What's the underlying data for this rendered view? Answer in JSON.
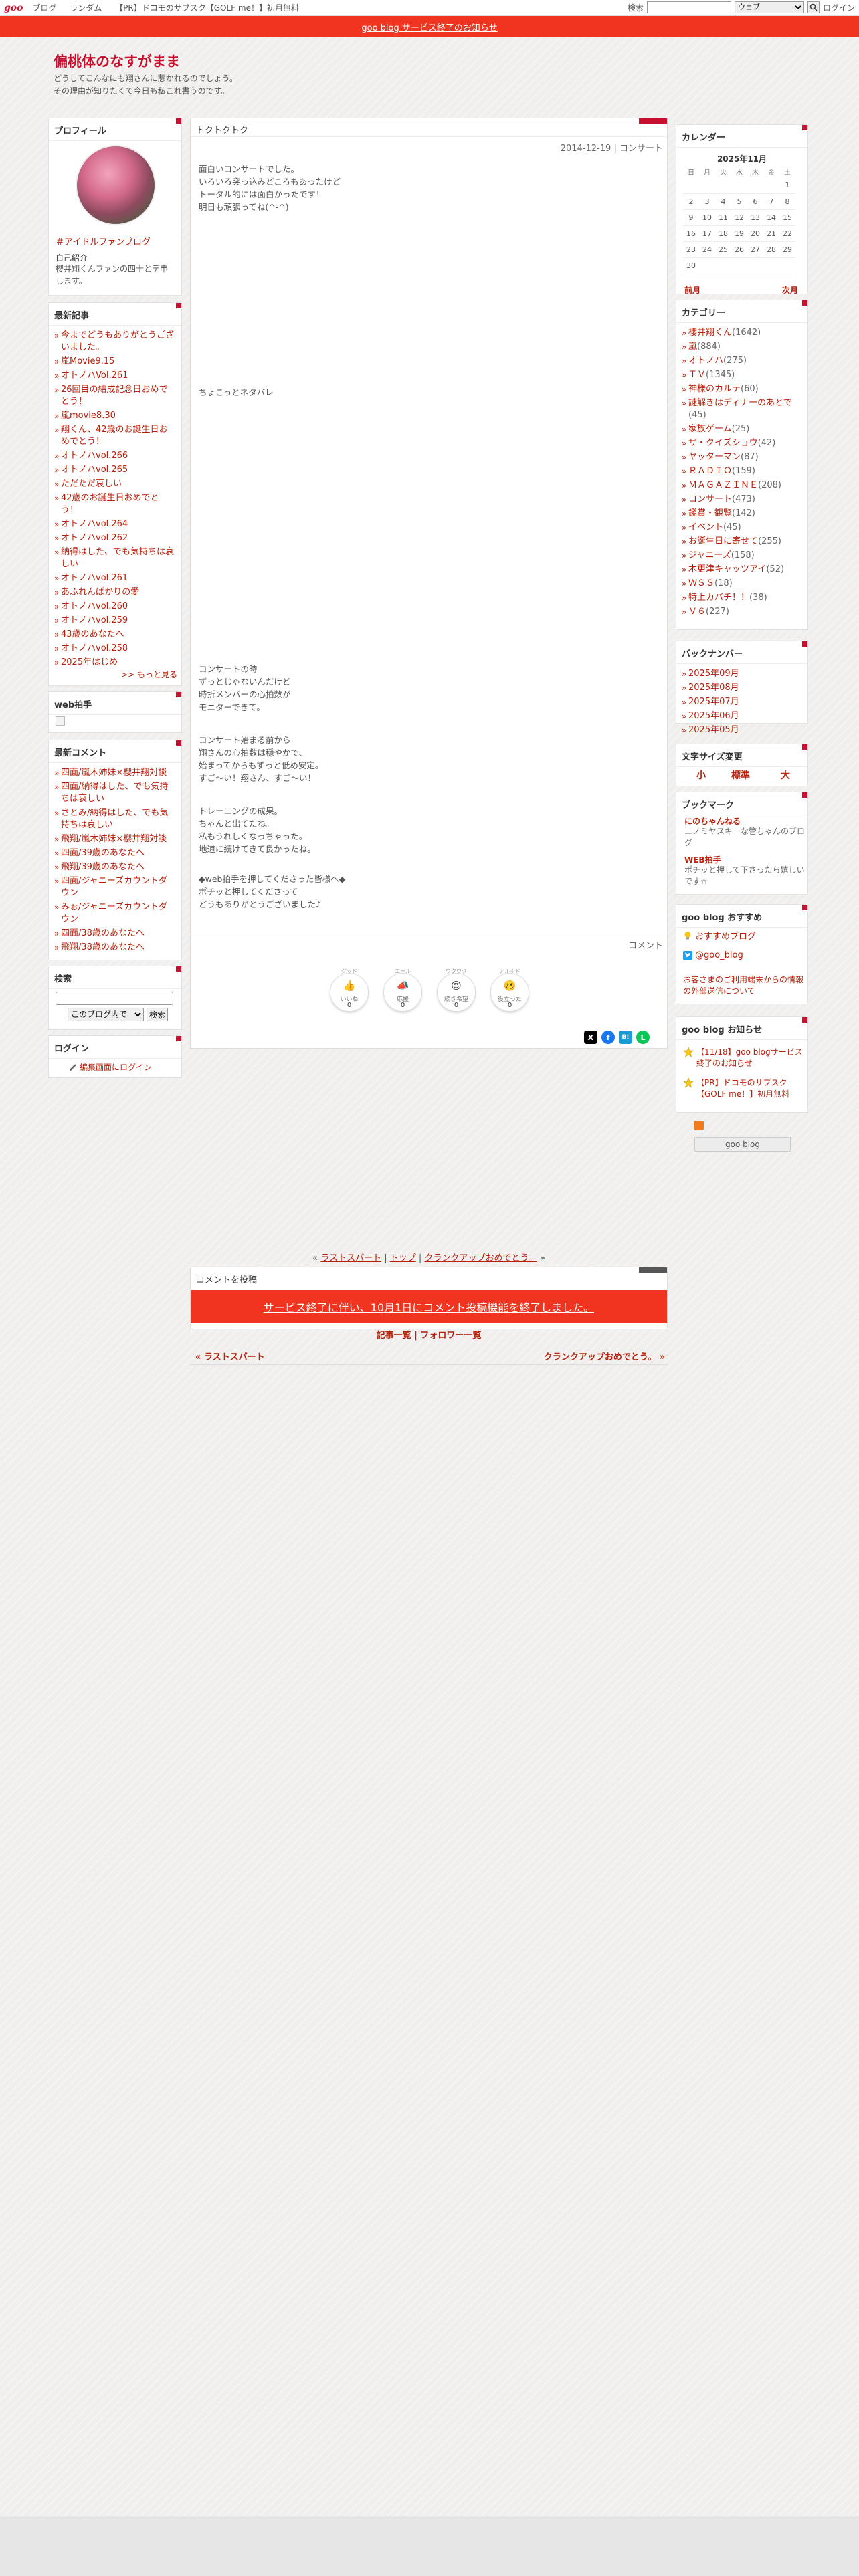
{
  "topbar": {
    "logo": "goo",
    "nav": [
      "ブログ",
      "ランダム",
      "【PR】ドコモのサブスク【GOLF me！】初月無料"
    ],
    "search_label": "検索",
    "search_value": "",
    "search_scope": "ウェブ",
    "login": "ログイン"
  },
  "notice": {
    "text": "goo blog サービス終了のお知らせ"
  },
  "header": {
    "title": "偏桃体のなすがまま",
    "desc_line1": "どうしてこんなにも翔さんに惹かれるのでしょう。",
    "desc_line2": "その理由が知りたくて今日も私これ書うのです。"
  },
  "profile": {
    "heading": "プロフィール",
    "fan_link": "＃アイドルファンブログ",
    "intro_title": "自己紹介",
    "intro": "櫻井翔くんファンの四十とデ申します。"
  },
  "recent_posts": {
    "heading": "最新記事",
    "items": [
      "今までどうもありがとうございました。",
      "嵐Movie9.15",
      "オトノハVol.261",
      "26回目の結成記念日おめでとう！",
      "嵐movie8.30",
      "翔くん、42歳のお誕生日おめでとう！",
      "オトノハvol.266",
      "オトノハvol.265",
      "ただただ哀しい",
      "42歳のお誕生日おめでとう！",
      "オトノハvol.264",
      "オトノハvol.262",
      "納得はした、でも気持ちは哀しい",
      "オトノハvol.261",
      "あふれんばかりの愛",
      "オトノハvol.260",
      "オトノハvol.259",
      "43歳のあなたへ",
      "オトノハvol.258",
      "2025年はじめ"
    ],
    "more": ">> もっと見る"
  },
  "web_clap": {
    "heading": "web拍手"
  },
  "recent_comments": {
    "heading": "最新コメント",
    "items": [
      "四面/嵐木姉妹×櫻井翔対談",
      "四面/納得はした、でも気持ちは哀しい",
      "さとみ/納得はした、でも気持ちは哀しい",
      "飛翔/嵐木姉妹×櫻井翔対談",
      "四面/39歳のあなたへ",
      "飛翔/39歳のあなたへ",
      "四面/ジャニーズカウントダウン",
      "みぉ/ジャニーズカウントダウン",
      "四面/38歳のあなたへ",
      "飛翔/38歳のあなたへ"
    ]
  },
  "search": {
    "heading": "検索",
    "scope": "このブログ内で",
    "button": "検索"
  },
  "login_box": {
    "heading": "ログイン",
    "link": "編集画面にログイン"
  },
  "post": {
    "tab_title": "トクトクトク",
    "date": "2014-12-19",
    "separator": "|",
    "category": "コンサート",
    "para1": [
      "面白いコンサートでした。",
      "いろいろ突っ込みどころもあったけど",
      "トータル的には面白かったです！",
      "明日も頑張ってね(^-^)"
    ],
    "para2": [
      "ちょこっとネタバレ"
    ],
    "para3": [
      "コンサートの時",
      "ずっとじゃないんだけど",
      "時折メンバーの心拍数が",
      "モニターできて。"
    ],
    "para4": [
      "コンサート始まる前から",
      "翔さんの心拍数は穏やかで、",
      "始まってからもずっと低め安定。",
      "すご〜い！翔さん、すご〜い！"
    ],
    "para5": [
      "トレーニングの成果。",
      "ちゃんと出てたね。",
      "私もうれしくなっちゃった。",
      "地道に続けてきて良かったね。"
    ],
    "para6": [
      "◆web拍手を押してくださった皆様へ◆",
      "ポチッと押してくださって",
      "どうもありがとうございました♪"
    ],
    "comment_link": "コメント",
    "reactions": [
      {
        "top": "グッド",
        "emoji": "👍",
        "label": "いいね",
        "count": "0"
      },
      {
        "top": "エール",
        "emoji": "📣",
        "label": "応援",
        "count": "0"
      },
      {
        "top": "ワクワク",
        "emoji": "😍",
        "label": "続き希望",
        "count": "0"
      },
      {
        "top": "ナルホド",
        "emoji": "🥴",
        "label": "役立った",
        "count": "0"
      }
    ],
    "share": [
      "X",
      "f",
      "B!",
      "L"
    ]
  },
  "post_nav": {
    "prev_arrow": "«",
    "prev": "ラストスパート",
    "sep": "|",
    "top": "トップ",
    "next": "クランクアップおめでとう。",
    "next_arrow": "»"
  },
  "comment_form": {
    "heading": "コメントを投稿",
    "notice": "サービス終了に伴い、10月1日にコメント投稿機能を終了しました。"
  },
  "list_links": {
    "articles": "記事一覧",
    "sep": "|",
    "follows": "フォロワー一覧"
  },
  "prev_post": "« ラストスパート",
  "next_post": "クランクアップおめでとう。 »",
  "calendar": {
    "heading": "カレンダー",
    "month": "2025年11月",
    "weekdays": [
      "日",
      "月",
      "火",
      "水",
      "木",
      "金",
      "土"
    ],
    "weeks": [
      [
        "",
        "",
        "",
        "",
        "",
        "",
        "1"
      ],
      [
        "2",
        "3",
        "4",
        "5",
        "6",
        "7",
        "8"
      ],
      [
        "9",
        "10",
        "11",
        "12",
        "13",
        "14",
        "15"
      ],
      [
        "16",
        "17",
        "18",
        "19",
        "20",
        "21",
        "22"
      ],
      [
        "23",
        "24",
        "25",
        "26",
        "27",
        "28",
        "29"
      ],
      [
        "30",
        "",
        "",
        "",
        "",
        "",
        ""
      ]
    ],
    "prev": "前月",
    "next": "次月"
  },
  "categories": {
    "heading": "カテゴリー",
    "items": [
      {
        "name": "櫻井翔くん",
        "count": "(1642)"
      },
      {
        "name": "嵐",
        "count": "(884)"
      },
      {
        "name": "オトノハ",
        "count": "(275)"
      },
      {
        "name": "ＴＶ",
        "count": "(1345)"
      },
      {
        "name": "神様のカルテ",
        "count": "(60)"
      },
      {
        "name": "謎解きはディナーのあとで",
        "count": "(45)"
      },
      {
        "name": "家族ゲーム",
        "count": "(25)"
      },
      {
        "name": "ザ・クイズショウ",
        "count": "(42)"
      },
      {
        "name": "ヤッターマン",
        "count": "(87)"
      },
      {
        "name": "ＲＡＤＩＯ",
        "count": "(159)"
      },
      {
        "name": "ＭＡＧＡＺＩＮＥ",
        "count": "(208)"
      },
      {
        "name": "コンサート",
        "count": "(473)"
      },
      {
        "name": "鑑賞・観覧",
        "count": "(142)"
      },
      {
        "name": "イベント",
        "count": "(45)"
      },
      {
        "name": "お誕生日に寄せて",
        "count": "(255)"
      },
      {
        "name": "ジャニーズ",
        "count": "(158)"
      },
      {
        "name": "木更津キャッツアイ",
        "count": "(52)"
      },
      {
        "name": "ＷＳＳ",
        "count": "(18)"
      },
      {
        "name": "特上カバチ！！",
        "count": "(38)"
      },
      {
        "name": "Ｖ６",
        "count": "(227)"
      }
    ]
  },
  "backnumber": {
    "heading": "バックナンバー",
    "items": [
      "2025年09月",
      "2025年08月",
      "2025年07月",
      "2025年06月",
      "2025年05月"
    ]
  },
  "font_size": {
    "heading": "文字サイズ変更",
    "small": "小",
    "medium": "標準",
    "large": "大"
  },
  "bookmarks": {
    "heading": "ブックマーク",
    "items": [
      {
        "title": "にのちゃんねる",
        "desc": "ニノミヤスキーな管ちゃんのブログ"
      },
      {
        "title": "WEB拍手",
        "desc": "ポチッと押して下さったら嬉しいです☆"
      }
    ]
  },
  "goo_recommend": {
    "heading": "goo blog おすすめ",
    "items": [
      "おすすめブログ",
      "@goo_blog"
    ],
    "note": "お客さまのご利用端末からの情報の外部送信について"
  },
  "goo_news": {
    "heading": "goo blog お知らせ",
    "items": [
      "【11/18】goo blogサービス終了のお知らせ",
      "【PR】ドコモのサブスク【GOLF me！】初月無料"
    ]
  },
  "badge": "goo blog",
  "colors": {
    "accent": "#c8102e",
    "notice_bg": "#f0341f",
    "link": "#b8200a"
  }
}
